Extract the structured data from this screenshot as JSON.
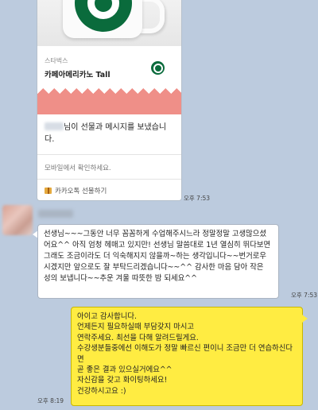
{
  "gift": {
    "brand": "스타벅스",
    "product": "카페아메리카노 Tall",
    "message_suffix": "님이 선물과 메시지를 보냈습니다.",
    "mobile_note": "모바일에서 확인하세요.",
    "kakao_gift_label": "카카오톡 선물하기",
    "time": "오후 7:53"
  },
  "incoming": {
    "text": "선생님~~~그동안 너무 꼼꼼하게 수업해주시느라 정말정말 고생많으셨어요^^ 아직 엄청 헤매고 있지만! 선생님 말씀대로 1년 열심히 뛰다보면 그래도 조금이라도 더 익숙해지지 않을까~하는 생각입니다~~번거로우시겠지만 앞으로도 잘 부탁드리겠습니다~~^^ 감사한 마음 담아 작은 성의 보냅니다~~추운 겨울 따뜻한 밤 되세요^^",
    "time": "오후 7:53"
  },
  "outgoing": {
    "text": "아이고 감사합니다.\n언제든지 필요하실때 부담갖지 마시고\n연락주세요. 최선을 다해 알려드릴게요.\n수강생분들중에선 이해도가 정말 빠르신 편이니 조금만 더 연습하신다면\n곧 좋은 결과 있으실거에요^^\n자신감을 갖고 화이팅하세요!\n건강하시고요 :)",
    "time": "오후 8:19"
  },
  "colors": {
    "chat_background": "#bccbde",
    "outgoing_bubble": "#ffec42",
    "starbucks_green": "#0a6b3c",
    "ribbon": "#ef8f88"
  }
}
